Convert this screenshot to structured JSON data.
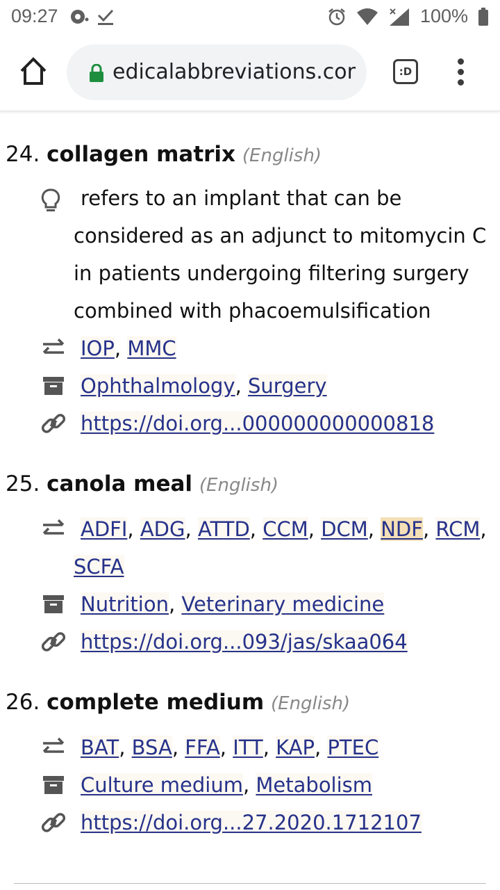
{
  "status_bar": {
    "time": "09:27",
    "battery": "100%"
  },
  "browser": {
    "url": "edicalabbreviations.com",
    "tabs_label": ":D"
  },
  "entries": [
    {
      "number": "24.",
      "term": "collagen matrix",
      "language": "(English)",
      "definition": "refers to an implant that can be considered as an adjunct to mitomycin C in patients undergoing filtering surgery combined with phacoemulsification",
      "definition_lines": [
        "refers to an implant that can be",
        "considered as an adjunct to mitomycin C",
        "in patients undergoing filtering surgery",
        "combined with phacoemulsification"
      ],
      "abbreviations": [
        "IOP",
        "MMC"
      ],
      "categories": [
        "Ophthalmology",
        "Surgery"
      ],
      "source": "https://doi.org...000000000000818"
    },
    {
      "number": "25.",
      "term": "canola meal",
      "language": "(English)",
      "abbreviations": [
        "ADFI",
        "ADG",
        "ATTD",
        "CCM",
        "DCM",
        "NDF",
        "RCM",
        "SCFA"
      ],
      "highlighted_abbreviation": "NDF",
      "categories": [
        "Nutrition",
        "Veterinary medicine"
      ],
      "source": "https://doi.org...093/jas/skaa064"
    },
    {
      "number": "26.",
      "term": "complete medium",
      "language": "(English)",
      "abbreviations": [
        "BAT",
        "BSA",
        "FFA",
        "ITT",
        "KAP",
        "PTEC"
      ],
      "categories": [
        "Culture medium",
        "Metabolism"
      ],
      "source": "https://doi.org...27.2020.1712107"
    }
  ],
  "colors": {
    "link": "#26328a",
    "highlight": "#f4dfb7",
    "icon": "#555555"
  },
  "icons": [
    "home-icon",
    "lock-icon",
    "lightbulb-icon",
    "swap-icon",
    "archive-icon",
    "link-icon"
  ]
}
